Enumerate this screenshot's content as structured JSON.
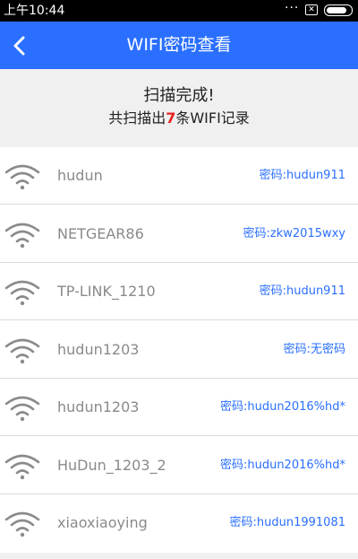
{
  "statusbar": {
    "time": "上午10:44",
    "dots": "···",
    "x_label": "✕",
    "battery_level": 0.85
  },
  "header": {
    "title": "WIFI密码查看",
    "back_icon": "chevron-left-icon"
  },
  "summary": {
    "line1": "扫描完成!",
    "line2_prefix": "共扫描出",
    "count": "7",
    "line2_suffix": "条WIFI记录"
  },
  "colors": {
    "accent": "#2a6fff",
    "count": "#e62020"
  },
  "networks": [
    {
      "ssid": "hudun",
      "password": "密码:hudun911"
    },
    {
      "ssid": "NETGEAR86",
      "password": "密码:zkw2015wxy"
    },
    {
      "ssid": "TP-LINK_1210",
      "password": "密码:hudun911"
    },
    {
      "ssid": "hudun1203",
      "password": "密码:无密码"
    },
    {
      "ssid": "hudun1203",
      "password": "密码:hudun2016%hd*"
    },
    {
      "ssid": "HuDun_1203_2",
      "password": "密码:hudun2016%hd*"
    },
    {
      "ssid": "xiaoxiaoying",
      "password": "密码:hudun1991081"
    }
  ]
}
